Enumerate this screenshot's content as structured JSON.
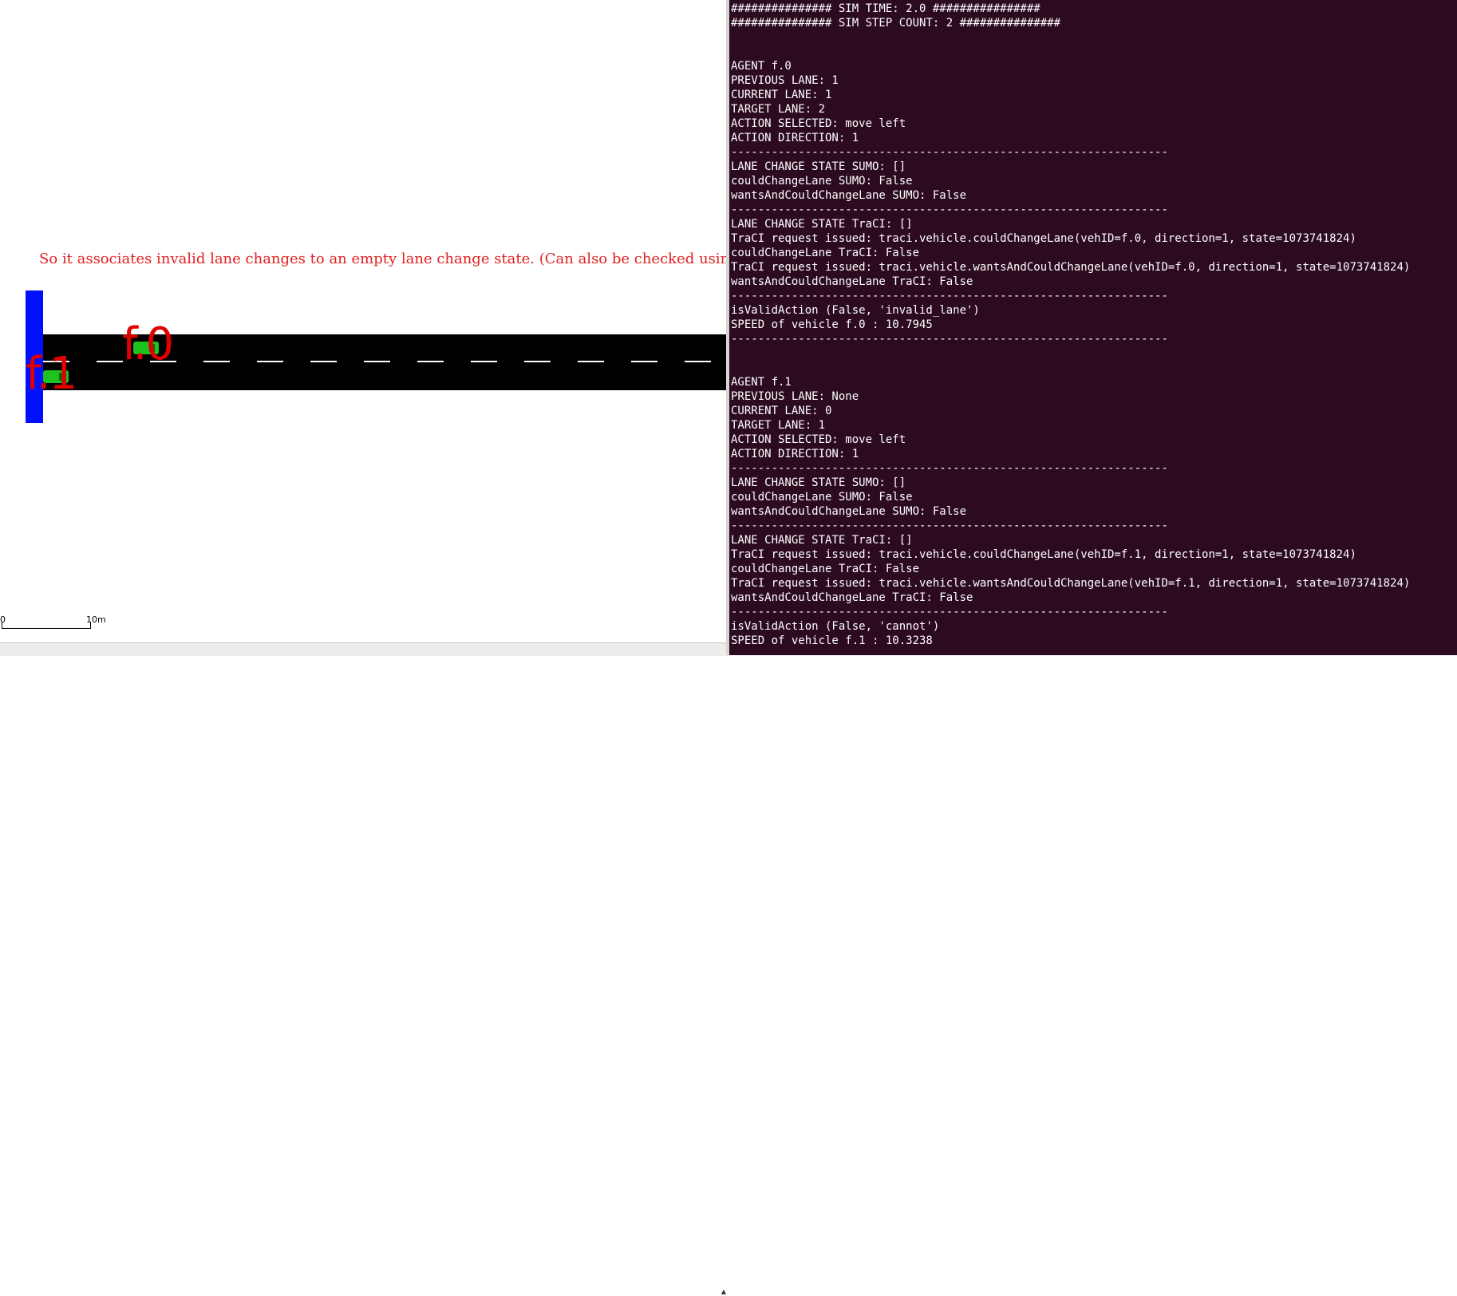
{
  "simulation": {
    "annotation": "So it associates invalid lane changes to an empty lane change state. (Can also be checked using lane index)",
    "vehicles": [
      {
        "id": "f.0",
        "label": "f.0"
      },
      {
        "id": "f.1",
        "label": "f.1"
      }
    ],
    "scale": {
      "start_label": "0",
      "end_label": "10m"
    },
    "colors": {
      "junction": "#0010ff",
      "road": "#000000",
      "vehicle": "#1ec21e",
      "label": "#e00000",
      "annotation": "#e02020"
    }
  },
  "terminal": {
    "background": "#2c0a1f",
    "lines": [
      "############### SIM TIME: 2.0 ################",
      "############### SIM STEP COUNT: 2 ###############",
      "",
      "",
      "AGENT f.0",
      "PREVIOUS LANE: 1",
      "CURRENT LANE: 1",
      "TARGET LANE: 2",
      "ACTION SELECTED: move left",
      "ACTION DIRECTION: 1",
      "-----------------------------------------------------------------",
      "LANE CHANGE STATE SUMO: []",
      "couldChangeLane SUMO: False",
      "wantsAndCouldChangeLane SUMO: False",
      "-----------------------------------------------------------------",
      "LANE CHANGE STATE TraCI: []",
      "TraCI request issued: traci.vehicle.couldChangeLane(vehID=f.0, direction=1, state=1073741824)",
      "couldChangeLane TraCI: False",
      "TraCI request issued: traci.vehicle.wantsAndCouldChangeLane(vehID=f.0, direction=1, state=1073741824)",
      "wantsAndCouldChangeLane TraCI: False",
      "-----------------------------------------------------------------",
      "isValidAction (False, 'invalid_lane')",
      "SPEED of vehicle f.0 : 10.7945",
      "-----------------------------------------------------------------",
      "",
      "",
      "AGENT f.1",
      "PREVIOUS LANE: None",
      "CURRENT LANE: 0",
      "TARGET LANE: 1",
      "ACTION SELECTED: move left",
      "ACTION DIRECTION: 1",
      "-----------------------------------------------------------------",
      "LANE CHANGE STATE SUMO: []",
      "couldChangeLane SUMO: False",
      "wantsAndCouldChangeLane SUMO: False",
      "-----------------------------------------------------------------",
      "LANE CHANGE STATE TraCI: []",
      "TraCI request issued: traci.vehicle.couldChangeLane(vehID=f.1, direction=1, state=1073741824)",
      "couldChangeLane TraCI: False",
      "TraCI request issued: traci.vehicle.wantsAndCouldChangeLane(vehID=f.1, direction=1, state=1073741824)",
      "wantsAndCouldChangeLane TraCI: False",
      "-----------------------------------------------------------------",
      "isValidAction (False, 'cannot')",
      "SPEED of vehicle f.1 : 10.3238"
    ]
  }
}
